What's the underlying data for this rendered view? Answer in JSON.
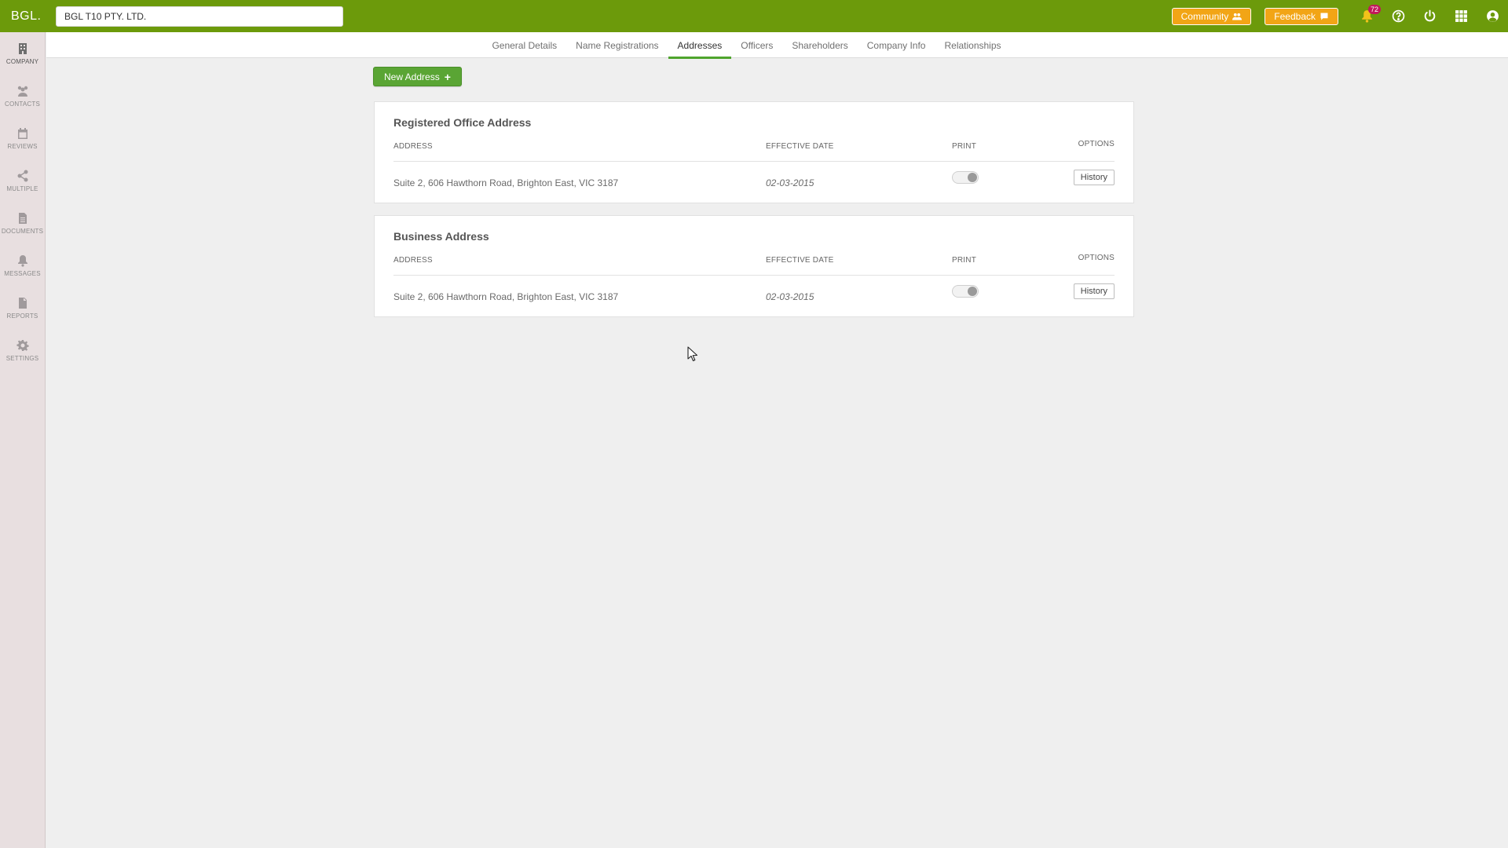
{
  "header": {
    "logo": "BGL.",
    "entity_value": "BGL T10 PTY. LTD.",
    "community_label": "Community",
    "feedback_label": "Feedback",
    "notification_count": "72",
    "brand_color": "#6c9a0b",
    "accent_color": "#f2a516"
  },
  "sidebar": {
    "items": [
      {
        "label": "COMPANY",
        "icon": "building-icon"
      },
      {
        "label": "CONTACTS",
        "icon": "people-icon"
      },
      {
        "label": "REVIEWS",
        "icon": "calendar-icon"
      },
      {
        "label": "MULTIPLE",
        "icon": "share-icon"
      },
      {
        "label": "DOCUMENTS",
        "icon": "document-icon"
      },
      {
        "label": "MESSAGES",
        "icon": "bell-icon"
      },
      {
        "label": "REPORTS",
        "icon": "report-icon"
      },
      {
        "label": "SETTINGS",
        "icon": "gear-icon"
      }
    ]
  },
  "tabs": [
    {
      "label": "General Details"
    },
    {
      "label": "Name Registrations"
    },
    {
      "label": "Addresses"
    },
    {
      "label": "Officers"
    },
    {
      "label": "Shareholders"
    },
    {
      "label": "Company Info"
    },
    {
      "label": "Relationships"
    }
  ],
  "main": {
    "new_address_label": "New Address",
    "columns": {
      "address": "ADDRESS",
      "effective_date": "EFFECTIVE DATE",
      "print": "PRINT",
      "options": "OPTIONS"
    },
    "cards": [
      {
        "title": "Registered Office Address",
        "address": "Suite 2, 606 Hawthorn Road, Brighton East, VIC 3187",
        "effective_date": "02-03-2015",
        "history_label": "History"
      },
      {
        "title": "Business Address",
        "address": "Suite 2, 606 Hawthorn Road, Brighton East, VIC 3187",
        "effective_date": "02-03-2015",
        "history_label": "History"
      }
    ]
  }
}
